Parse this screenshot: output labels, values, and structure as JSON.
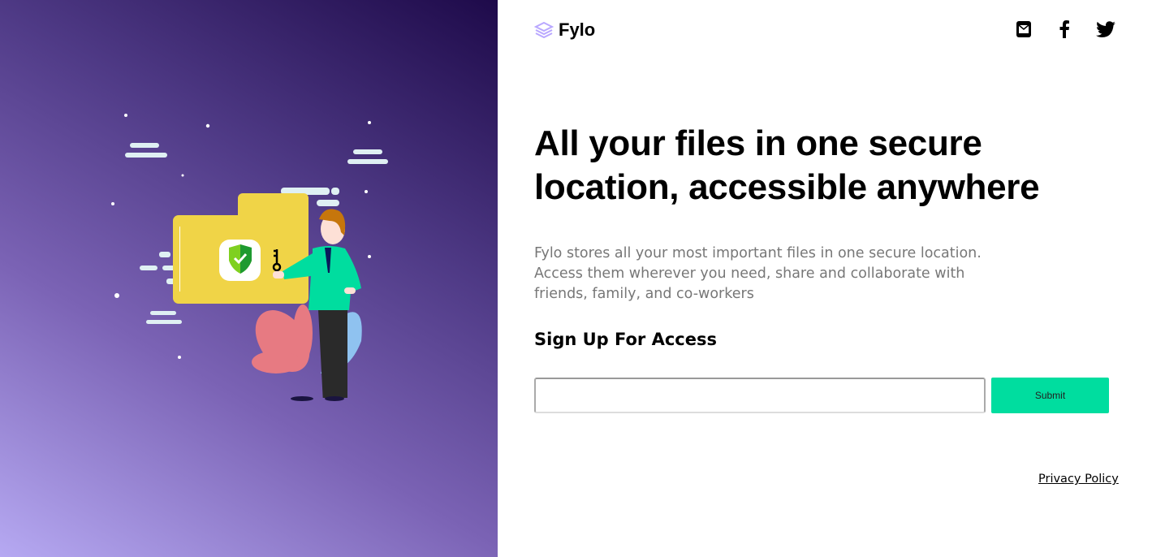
{
  "brand": {
    "name": "Fylo",
    "logo_color": "#b9a8ff"
  },
  "social": [
    {
      "icon": "email-icon"
    },
    {
      "icon": "facebook-icon"
    },
    {
      "icon": "twitter-icon"
    }
  ],
  "hero": {
    "title": "All your files in one secure location, accessible anywhere",
    "description": "Fylo stores all your most important files in one secure location. Access them wherever you need, share and collaborate with friends, family, and co-workers"
  },
  "signup": {
    "heading": "Sign Up For Access",
    "email_value": "",
    "email_placeholder": "",
    "submit_label": "Submit",
    "accent": "#00dd9f"
  },
  "footer": {
    "privacy_label": "Privacy Policy"
  }
}
